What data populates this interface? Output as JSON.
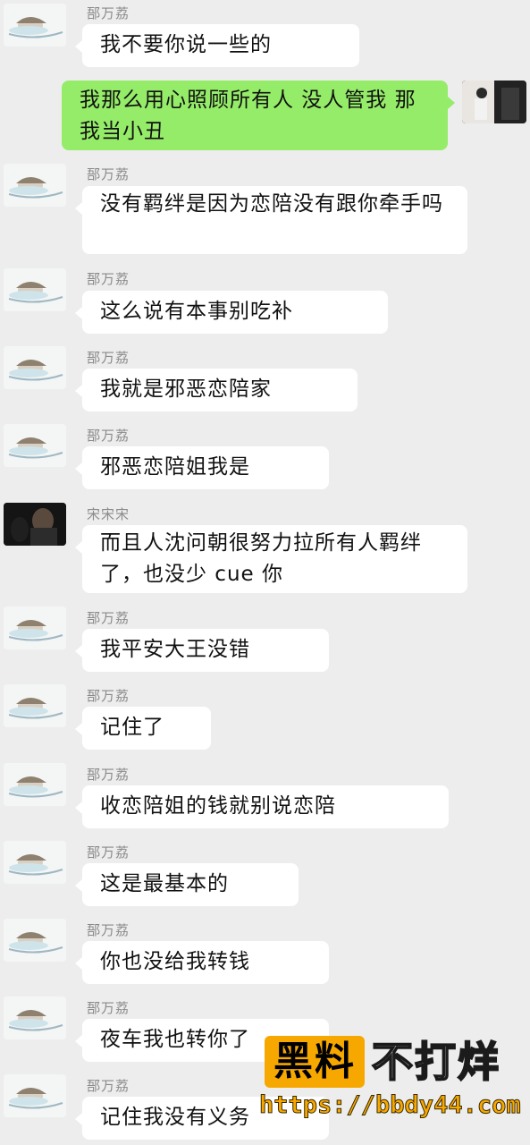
{
  "messages": [
    {
      "side": "left",
      "sender": "郚万荔",
      "avatar": "sleeping-character-avatar",
      "text": "我不要你说一些的"
    },
    {
      "side": "right",
      "avatar": "user-photo-avatar",
      "text": "我那么用心照顾所有人 没人管我 那我当小丑"
    },
    {
      "side": "left",
      "sender": "郚万荔",
      "avatar": "sleeping-character-avatar",
      "text": "没有羁绊是因为恋陪没有跟你牵手吗"
    },
    {
      "side": "left",
      "sender": "郚万荔",
      "avatar": "sleeping-character-avatar",
      "text": "这么说有本事别吃补"
    },
    {
      "side": "left",
      "sender": "郚万荔",
      "avatar": "sleeping-character-avatar",
      "text": "我就是邪恶恋陪家"
    },
    {
      "side": "left",
      "sender": "郚万荔",
      "avatar": "sleeping-character-avatar",
      "text": "邪恶恋陪姐我是"
    },
    {
      "side": "left",
      "sender": "宋宋宋",
      "avatar": "dark-photo-avatar",
      "text": "而且人沈问朝很努力拉所有人羁绊了，也没少 cue 你"
    },
    {
      "side": "left",
      "sender": "郚万荔",
      "avatar": "sleeping-character-avatar",
      "text": "我平安大王没错"
    },
    {
      "side": "left",
      "sender": "郚万荔",
      "avatar": "sleeping-character-avatar",
      "text": "记住了"
    },
    {
      "side": "left",
      "sender": "郚万荔",
      "avatar": "sleeping-character-avatar",
      "text": "收恋陪姐的钱就别说恋陪"
    },
    {
      "side": "left",
      "sender": "郚万荔",
      "avatar": "sleeping-character-avatar",
      "text": "这是最基本的"
    },
    {
      "side": "left",
      "sender": "郚万荔",
      "avatar": "sleeping-character-avatar",
      "text": "你也没给我转钱"
    },
    {
      "side": "left",
      "sender": "郚万荔",
      "avatar": "sleeping-character-avatar",
      "text": "夜车我也转你了"
    },
    {
      "side": "left",
      "sender": "郚万荔",
      "avatar": "sleeping-character-avatar",
      "text": "记住我没有义务"
    }
  ],
  "watermark": {
    "badge": "黑料",
    "tail": "不打烊",
    "url": "https://bbdy44.com"
  },
  "colors": {
    "background": "#ededed",
    "bubble_left": "#ffffff",
    "bubble_right": "#95ec69",
    "sender_name": "#8a8a8a",
    "watermark_accent": "#f7a800"
  }
}
